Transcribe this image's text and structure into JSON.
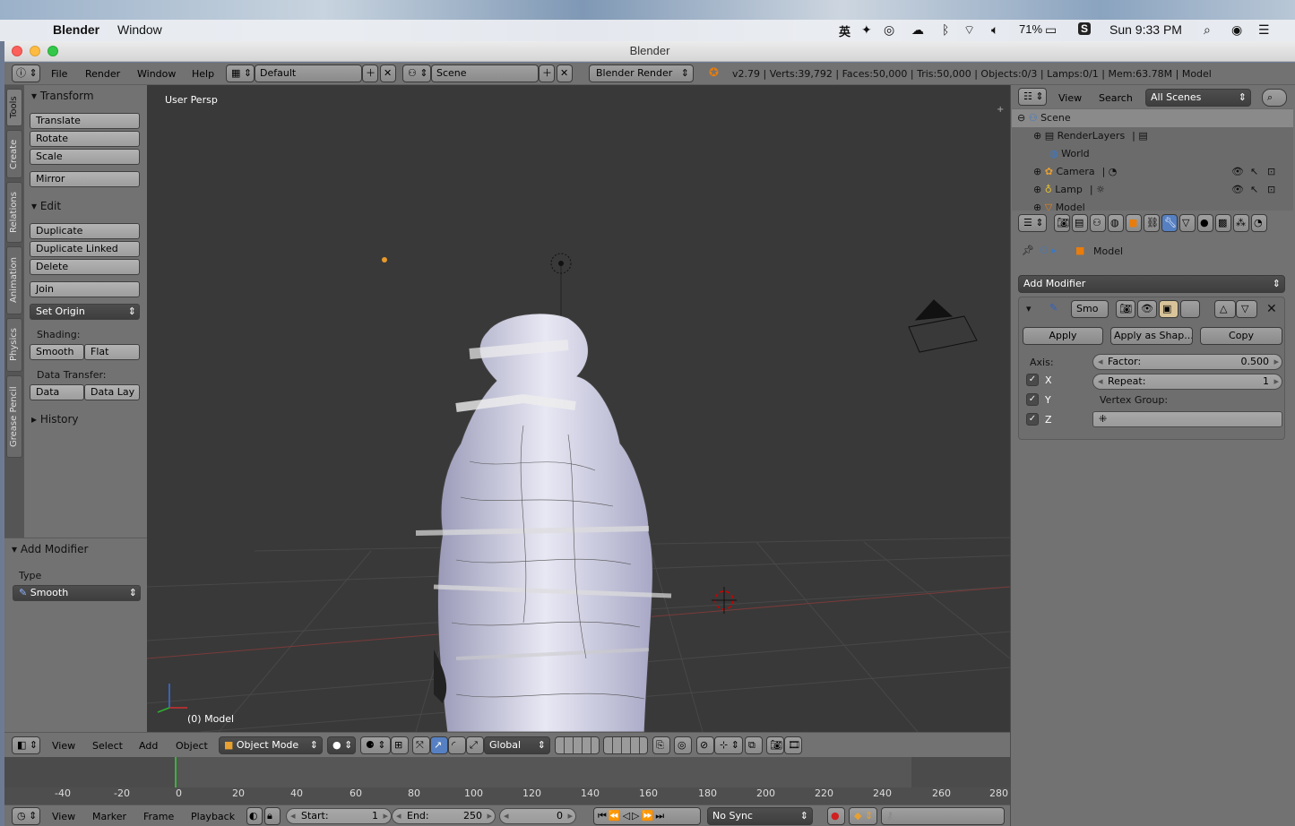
{
  "menubar": {
    "app": "Blender",
    "menu": "Window",
    "battery": "71%",
    "clock": "Sun 9:33 PM"
  },
  "window": {
    "title": "Blender"
  },
  "header": {
    "menus": [
      "File",
      "Render",
      "Window",
      "Help"
    ],
    "layout": "Default",
    "scene": "Scene",
    "engine": "Blender Render",
    "stats": "v2.79 | Verts:39,792 | Faces:50,000 | Tris:50,000 | Objects:0/3 | Lamps:0/1 | Mem:63.78M | Model"
  },
  "tabs": [
    "Tools",
    "Create",
    "Relations",
    "Animation",
    "Physics",
    "Grease Pencil"
  ],
  "tool_shelf": {
    "transform": {
      "title": "Transform",
      "buttons": [
        "Translate",
        "Rotate",
        "Scale",
        "Mirror"
      ]
    },
    "edit": {
      "title": "Edit",
      "buttons": [
        "Duplicate",
        "Duplicate Linked",
        "Delete",
        "Join"
      ],
      "set_origin": "Set Origin",
      "shading_label": "Shading:",
      "smooth": "Smooth",
      "flat": "Flat",
      "data_transfer_label": "Data Transfer:",
      "data": "Data",
      "data_lay": "Data Lay"
    },
    "history": "History"
  },
  "redo_panel": {
    "title": "Add Modifier",
    "type_label": "Type",
    "type_value": "Smooth"
  },
  "viewport": {
    "view_label": "User Persp",
    "object_label": "(0) Model"
  },
  "viewport_header": {
    "menus": [
      "View",
      "Select",
      "Add",
      "Object"
    ],
    "mode": "Object Mode",
    "orientation": "Global"
  },
  "timeline": {
    "ticks": [
      "-40",
      "-20",
      "0",
      "20",
      "40",
      "60",
      "80",
      "100",
      "120",
      "140",
      "160",
      "180",
      "200",
      "220",
      "240",
      "260",
      "280"
    ],
    "menus": [
      "View",
      "Marker",
      "Frame",
      "Playback"
    ],
    "start_label": "Start:",
    "start": "1",
    "end_label": "End:",
    "end": "250",
    "current": "0",
    "sync": "No Sync"
  },
  "outliner": {
    "menus": [
      "View",
      "Search"
    ],
    "filter": "All Scenes",
    "rows": [
      "Scene",
      "RenderLayers",
      "World",
      "Camera",
      "Lamp",
      "Model"
    ]
  },
  "properties": {
    "object": "Model",
    "add_modifier": "Add Modifier",
    "modifier_name": "Smo",
    "apply": "Apply",
    "apply_shape": "Apply as Shap...",
    "copy": "Copy",
    "axis_label": "Axis:",
    "axes": [
      "X",
      "Y",
      "Z"
    ],
    "factor_label": "Factor:",
    "factor": "0.500",
    "repeat_label": "Repeat:",
    "repeat": "1",
    "vertex_group_label": "Vertex Group:"
  },
  "colors": {
    "accent": "#5680c2",
    "viewport_bg": "#393939",
    "panel": "#727272",
    "frame_line": "#3cb33c"
  }
}
